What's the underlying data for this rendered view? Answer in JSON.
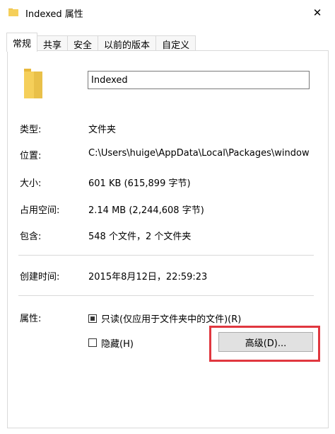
{
  "window": {
    "title": "Indexed 属性",
    "close_glyph": "✕"
  },
  "tabs": [
    {
      "label": "常规",
      "active": true
    },
    {
      "label": "共享",
      "active": false
    },
    {
      "label": "安全",
      "active": false
    },
    {
      "label": "以前的版本",
      "active": false
    },
    {
      "label": "自定义",
      "active": false
    }
  ],
  "general": {
    "folder_name": "Indexed",
    "rows": {
      "type": {
        "label": "类型:",
        "value": "文件夹"
      },
      "location": {
        "label": "位置:",
        "value": "C:\\Users\\huige\\AppData\\Local\\Packages\\window"
      },
      "size": {
        "label": "大小:",
        "value": "601 KB (615,899 字节)"
      },
      "size_on_disk": {
        "label": "占用空间:",
        "value": "2.14 MB (2,244,608 字节)"
      },
      "contains": {
        "label": "包含:",
        "value": "548 个文件，2 个文件夹"
      },
      "created": {
        "label": "创建时间:",
        "value": "2015年8月12日，22:59:23"
      }
    },
    "attributes": {
      "label": "属性:",
      "readonly": {
        "label": "只读(仅应用于文件夹中的文件)(R)",
        "checked": true
      },
      "hidden": {
        "label": "隐藏(H)",
        "checked": false
      },
      "advanced_button": "高级(D)..."
    }
  },
  "colors": {
    "folder_yellow": "#f5cf5a",
    "highlight_red": "#e0373f"
  },
  "icons": {
    "title": "folder-icon",
    "large": "folder-icon",
    "close": "close-icon"
  }
}
